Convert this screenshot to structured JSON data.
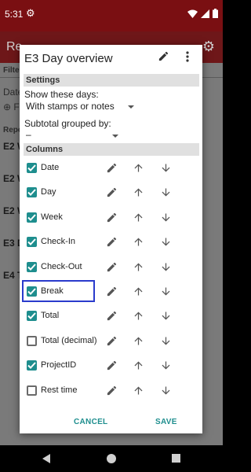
{
  "status_bar": {
    "time": "5:31"
  },
  "background_app": {
    "title": "Re",
    "filter_label": "Filte",
    "date_label": "Date",
    "fi_link": "⊕ Fi",
    "report_label": "Repo",
    "rows": [
      "E2 W",
      "E2 W",
      "E2 W",
      "E3 D",
      "E4 T"
    ]
  },
  "dialog": {
    "title": "E3 Day overview",
    "settings_header": "Settings",
    "show_days_label": "Show these days:",
    "show_days_value": "With stamps or notes",
    "subtotal_label": "Subtotal grouped by:",
    "subtotal_value": "–",
    "columns_header": "Columns",
    "columns": [
      {
        "label": "Date",
        "checked": true
      },
      {
        "label": "Day",
        "checked": true
      },
      {
        "label": "Week",
        "checked": true
      },
      {
        "label": "Check-In",
        "checked": true
      },
      {
        "label": "Check-Out",
        "checked": true
      },
      {
        "label": "Break",
        "checked": true,
        "focused": true
      },
      {
        "label": "Total",
        "checked": true
      },
      {
        "label": "Total (decimal)",
        "checked": false
      },
      {
        "label": "ProjectID",
        "checked": true
      },
      {
        "label": "Rest time",
        "checked": false
      }
    ],
    "cancel_label": "CANCEL",
    "save_label": "SAVE"
  },
  "colors": {
    "accent": "#1e8e8e",
    "status_bar": "#7a0f12",
    "toolbar": "#6e1719",
    "focus": "#2a3bcc"
  }
}
